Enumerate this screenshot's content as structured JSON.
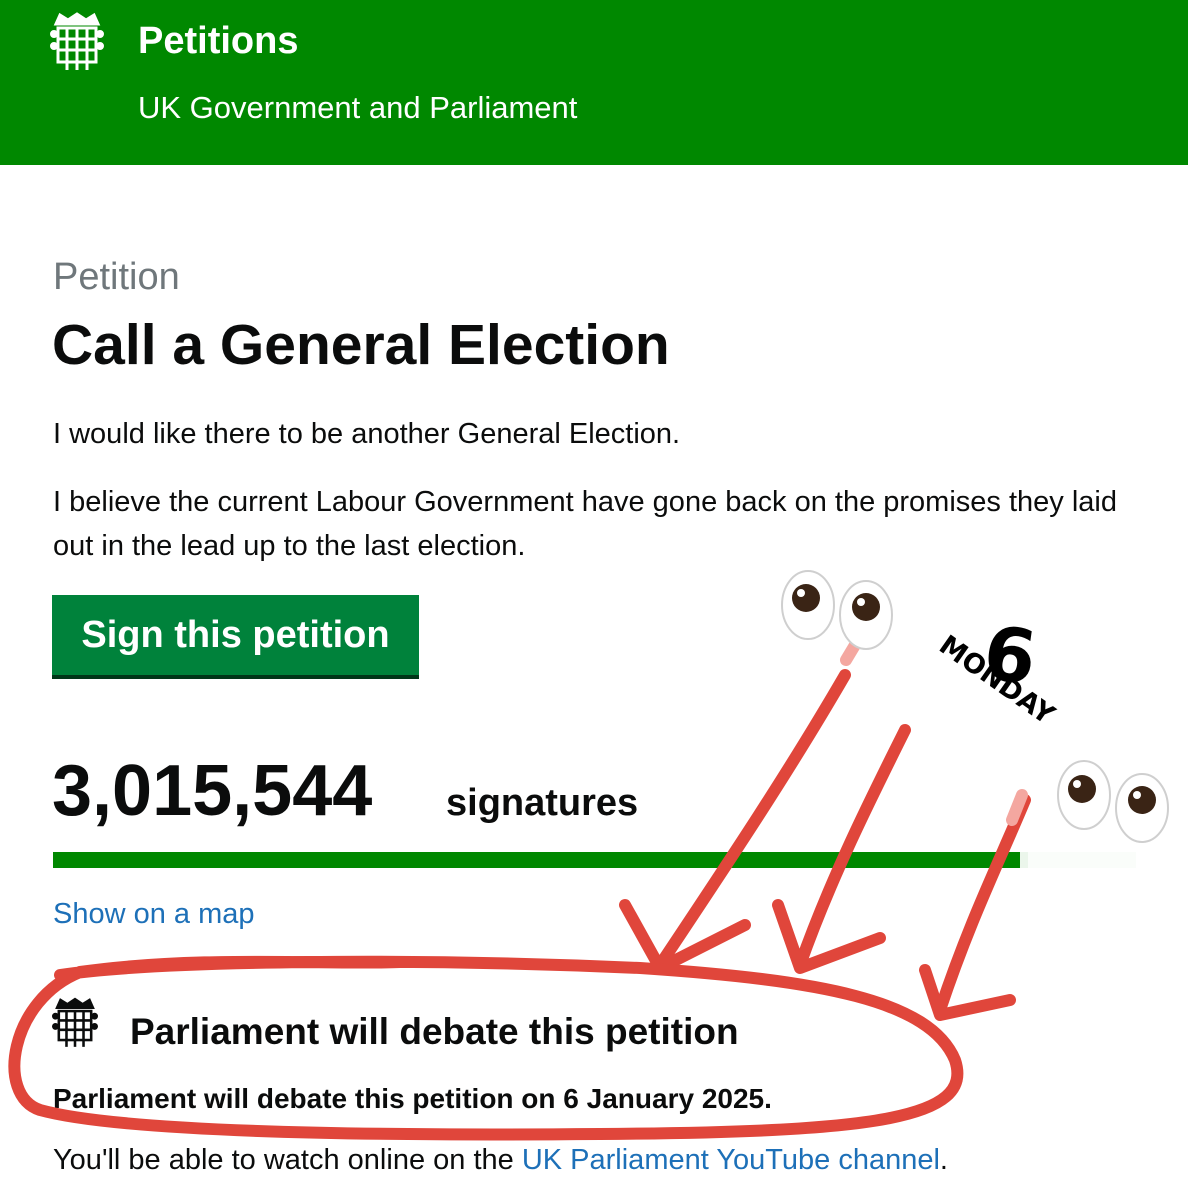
{
  "header": {
    "site_title": "Petitions",
    "site_subtitle": "UK Government and Parliament",
    "logo_icon": "portcullis-icon",
    "background_color": "#008800"
  },
  "petition": {
    "kicker": "Petition",
    "title": "Call a General Election",
    "paragraph_1": "I would like there to be another General Election.",
    "paragraph_2": "I believe the current Labour Government have gone back on the promises they laid out in the lead up to the last election.",
    "sign_button_label": "Sign this petition",
    "signature_count": "3,015,544",
    "signature_label": "signatures",
    "progress_fraction": 0.9,
    "map_link_label": "Show on a map"
  },
  "debate": {
    "icon": "portcullis-icon",
    "heading": "Parliament will debate this petition",
    "date_text": "Parliament will debate this petition on 6 January 2025.",
    "watch_prefix": "You'll be able to watch online on the ",
    "watch_link_label": "UK Parliament YouTube channel",
    "watch_suffix": "."
  },
  "annotation": {
    "calendar_day": "6",
    "calendar_weekday": "MONDAY",
    "emoji": "eyes",
    "marker_color": "#e0463b"
  }
}
